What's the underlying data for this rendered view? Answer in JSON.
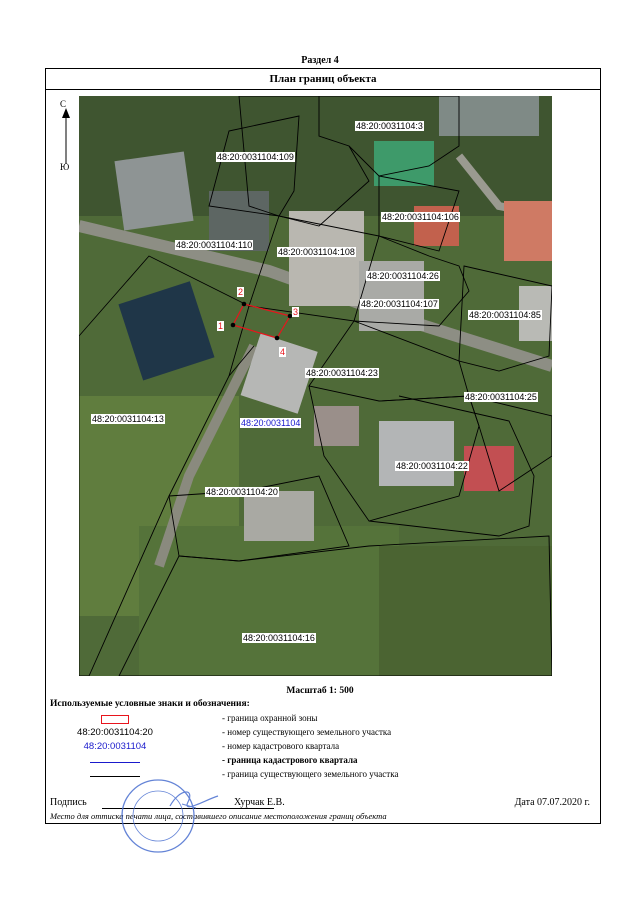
{
  "section_title": "Раздел 4",
  "plan_title": "План границ объекта",
  "compass": {
    "north": "С",
    "south": "Ю"
  },
  "parcels": [
    "48:20:0031104:3",
    "48:20:0031104:109",
    "48:20:0031104:106",
    "48:20:0031104:110",
    "48:20:0031104:108",
    "48:20:0031104:26",
    "48:20:0031104:107",
    "48:20:0031104:85",
    "48:20:0031104:23",
    "48:20:0031104:25",
    "48:20:0031104:13",
    "48:20:0031104:22",
    "48:20:0031104:20",
    "48:20:0031104:16"
  ],
  "quarter_number": "48:20:0031104",
  "points": [
    "1",
    "2",
    "3",
    "4"
  ],
  "scale_text": "Масштаб 1: 500",
  "legend": {
    "title": "Используемые условные знаки и обозначения:",
    "items": [
      {
        "symbol_text": "",
        "text": "- граница  охранной зоны"
      },
      {
        "symbol_text": "48:20:0031104:20",
        "text": "- номер существующего земельного участка"
      },
      {
        "symbol_text": "48:20:0031104",
        "text": "- номер кадастрового квартала"
      },
      {
        "symbol_text": "",
        "text": "- граница кадастрового квартала"
      },
      {
        "symbol_text": "",
        "text": "- граница существующего земельного участка"
      }
    ]
  },
  "signature": {
    "label": "Подпись",
    "signer": "Хурчак Е.В.",
    "date": "Дата 07.07.2020 г.",
    "stamp_note": "Место для оттиска печати лица, составившего описание местоположения границ объекта"
  },
  "colors": {
    "zone_boundary": "#e8141c",
    "quarter_number": "#1a1acc",
    "quarter_boundary": "#1a1acc",
    "parcel_boundary": "#000000",
    "stamp": "#4a6fd0"
  }
}
